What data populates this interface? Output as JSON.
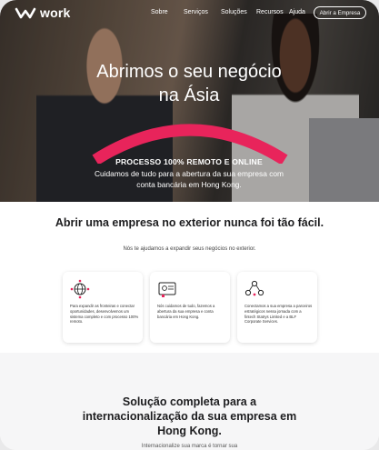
{
  "nav": {
    "logo_text": "work",
    "links": [
      "Sobre",
      "Serviços",
      "Soluções",
      "Recursos",
      "Ajuda"
    ],
    "cta_label": "Abrir a Empresa"
  },
  "hero": {
    "title": "Abrimos o seu negócio na Ásia",
    "subtitle": "PROCESSO 100% REMOTO E ONLINE",
    "description": "Cuidamos de tudo para a abertura da sua empresa com conta bancária em Hong Kong.",
    "arc_color": "#e8245b"
  },
  "section2": {
    "title": "Abrir uma empresa no exterior nunca foi tão fácil.",
    "subtitle": "Nós te ajudamos a expandir seus negócios no exterior.",
    "cards": [
      {
        "icon": "globe-network-icon",
        "text": "Para expandir as fronteiras e conectar oportunidades, desenvolvemos um sistema completo e com processo 100% remoto."
      },
      {
        "icon": "bank-document-icon",
        "text": "Nós cuidamos de tudo, fazemos a abertura da sua empresa e conta bancária em Hong Kong."
      },
      {
        "icon": "people-network-icon",
        "text": "Conectamos a sua empresa a parceiros estratégicos nessa jornada com a fintech Statrys Limited e a BLF Corporate Services."
      }
    ]
  },
  "section3": {
    "title": "Solução completa para a internacionalização da sua empresa em Hong Kong.",
    "description": "Internacionalize sua marca é tornar sua"
  }
}
